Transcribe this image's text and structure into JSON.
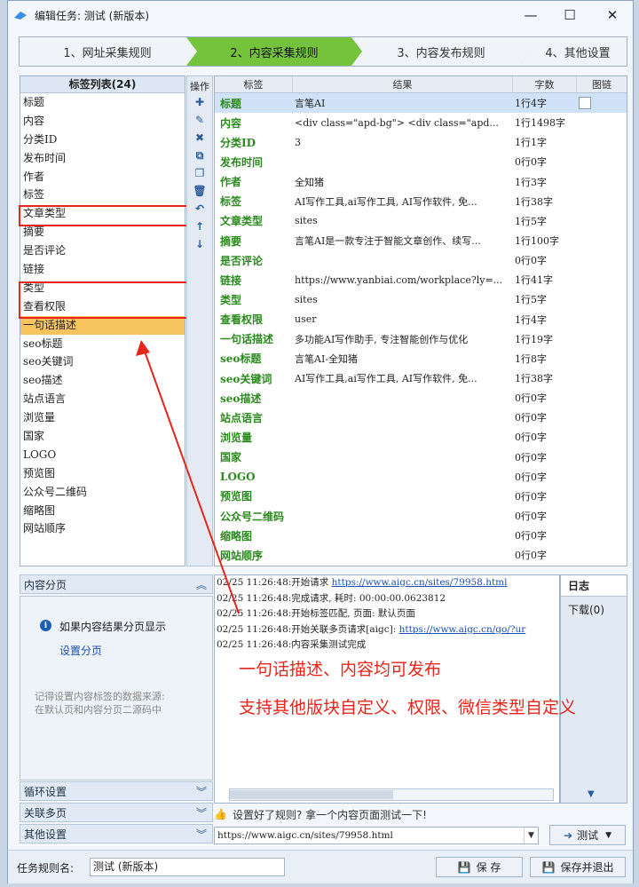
{
  "window": {
    "title": "编辑任务: 测试 (新版本)",
    "min_glyph": "—",
    "max_glyph": "☐",
    "close_glyph": "✕"
  },
  "steps": [
    {
      "label": "1、网址采集规则",
      "active": false
    },
    {
      "label": "2、内容采集规则",
      "active": true
    },
    {
      "label": "3、内容发布规则",
      "active": false
    },
    {
      "label": "4、其他设置",
      "active": false
    }
  ],
  "tag_list": {
    "header": "标签列表(24)",
    "items": [
      "标题",
      "内容",
      "分类ID",
      "发布时间",
      "作者",
      "标签",
      "文章类型",
      "摘要",
      "是否评论",
      "链接",
      "类型",
      "查看权限",
      "一句话描述",
      "seo标题",
      "seo关键词",
      "seo描述",
      "站点语言",
      "浏览量",
      "国家",
      "LOGO",
      "预览图",
      "公众号二维码",
      "缩略图",
      "网站顺序"
    ],
    "selected_index": 12
  },
  "ops": {
    "label": "操作",
    "icons": [
      "add-icon",
      "edit-icon",
      "delete-icon",
      "copy-icon",
      "paste-icon",
      "trash-icon",
      "undo-icon",
      "move-up-icon",
      "move-down-icon"
    ],
    "glyphs": [
      "✚",
      "✎",
      "✖",
      "⧉",
      "❐",
      "🗑",
      "↶",
      "↑",
      "↓"
    ]
  },
  "grid": {
    "columns": [
      "标签",
      "结果",
      "字数",
      "图链"
    ],
    "rows": [
      {
        "tag": "标题",
        "result": "言笔AI",
        "count": "1行4字"
      },
      {
        "tag": "内容",
        "result": " <div class=\"apd-bg\"> <div class=\"apd...",
        "count": "1行1498字"
      },
      {
        "tag": "分类ID",
        "result": "3",
        "count": "1行1字"
      },
      {
        "tag": "发布时间",
        "result": "",
        "count": "0行0字"
      },
      {
        "tag": "作者",
        "result": "全知猪",
        "count": "1行3字"
      },
      {
        "tag": "标签",
        "result": "AI写作工具,ai写作工具, AI写作软件, 免...",
        "count": "1行38字"
      },
      {
        "tag": "文章类型",
        "result": "sites",
        "count": "1行5字"
      },
      {
        "tag": "摘要",
        "result": "言笔AI是一款专注于智能文章创作、续写...",
        "count": "1行100字"
      },
      {
        "tag": "是否评论",
        "result": "",
        "count": "0行0字"
      },
      {
        "tag": "链接",
        "result": "https://www.yanbiai.com/workplace?ly=...",
        "count": "1行41字"
      },
      {
        "tag": "类型",
        "result": "sites",
        "count": "1行5字"
      },
      {
        "tag": "查看权限",
        "result": "user",
        "count": "1行4字"
      },
      {
        "tag": "一句话描述",
        "result": "多功能AI写作助手, 专注智能创作与优化",
        "count": "1行19字"
      },
      {
        "tag": "seo标题",
        "result": "言笔AI-全知猪",
        "count": "1行8字"
      },
      {
        "tag": "seo关键词",
        "result": "AI写作工具,ai写作工具, AI写作软件, 免...",
        "count": "1行38字"
      },
      {
        "tag": "seo描述",
        "result": "",
        "count": "0行0字"
      },
      {
        "tag": "站点语言",
        "result": "",
        "count": "0行0字"
      },
      {
        "tag": "浏览量",
        "result": "",
        "count": "0行0字"
      },
      {
        "tag": "国家",
        "result": "",
        "count": "0行0字"
      },
      {
        "tag": "LOGO",
        "result": "",
        "count": "0行0字"
      },
      {
        "tag": "预览图",
        "result": "",
        "count": "0行0字"
      },
      {
        "tag": "公众号二维码",
        "result": "",
        "count": "0行0字"
      },
      {
        "tag": "缩略图",
        "result": "",
        "count": "0行0字"
      },
      {
        "tag": "网站顺序",
        "result": "",
        "count": "0行0字"
      }
    ]
  },
  "paging": {
    "header": "内容分页",
    "info": "如果内容结果分页显示",
    "link": "设置分页",
    "note_line1": "记得设置内容标签的数据来源:",
    "note_line2": "在默认页和内容分页二源码中"
  },
  "sections": [
    "循环设置",
    "关联多页",
    "其他设置"
  ],
  "log": {
    "lines": [
      {
        "text": "02/25 11:26:48:开始请求 ",
        "link": "https://www.aigc.cn/sites/79958.html"
      },
      {
        "text": "02/25 11:26:48:完成请求, 耗时: 00:00:00.0623812",
        "link": ""
      },
      {
        "text": "02/25 11:26:48:开始标签匹配, 页面: 默认页面",
        "link": ""
      },
      {
        "text": "02/25 11:26:48:开始关联多页请求[aigc]: ",
        "link": "https://www.aigc.cn/go/?ur"
      },
      {
        "text": "02/25 11:26:48:内容采集测试完成",
        "link": ""
      }
    ],
    "side_tab": "日志",
    "side_item": "下载(0)"
  },
  "annotations": {
    "line1": "一句话描述、内容均可发布",
    "line2": "支持其他版块自定义、权限、微信类型自定义"
  },
  "test": {
    "hint": "设置好了规则? 拿一个内容页面测试一下!",
    "url": "https://www.aigc.cn/sites/79958.html",
    "button": "测试"
  },
  "footer": {
    "name_label": "任务规则名:",
    "name_value": "测试 (新版本)",
    "save": "保 存",
    "save_exit": "保存并退出"
  },
  "colors": {
    "accent_green": "#75c23b",
    "tag_green": "#2b8a1e",
    "highlight_red": "#e8251a",
    "selected_orange": "#f7c35f"
  }
}
